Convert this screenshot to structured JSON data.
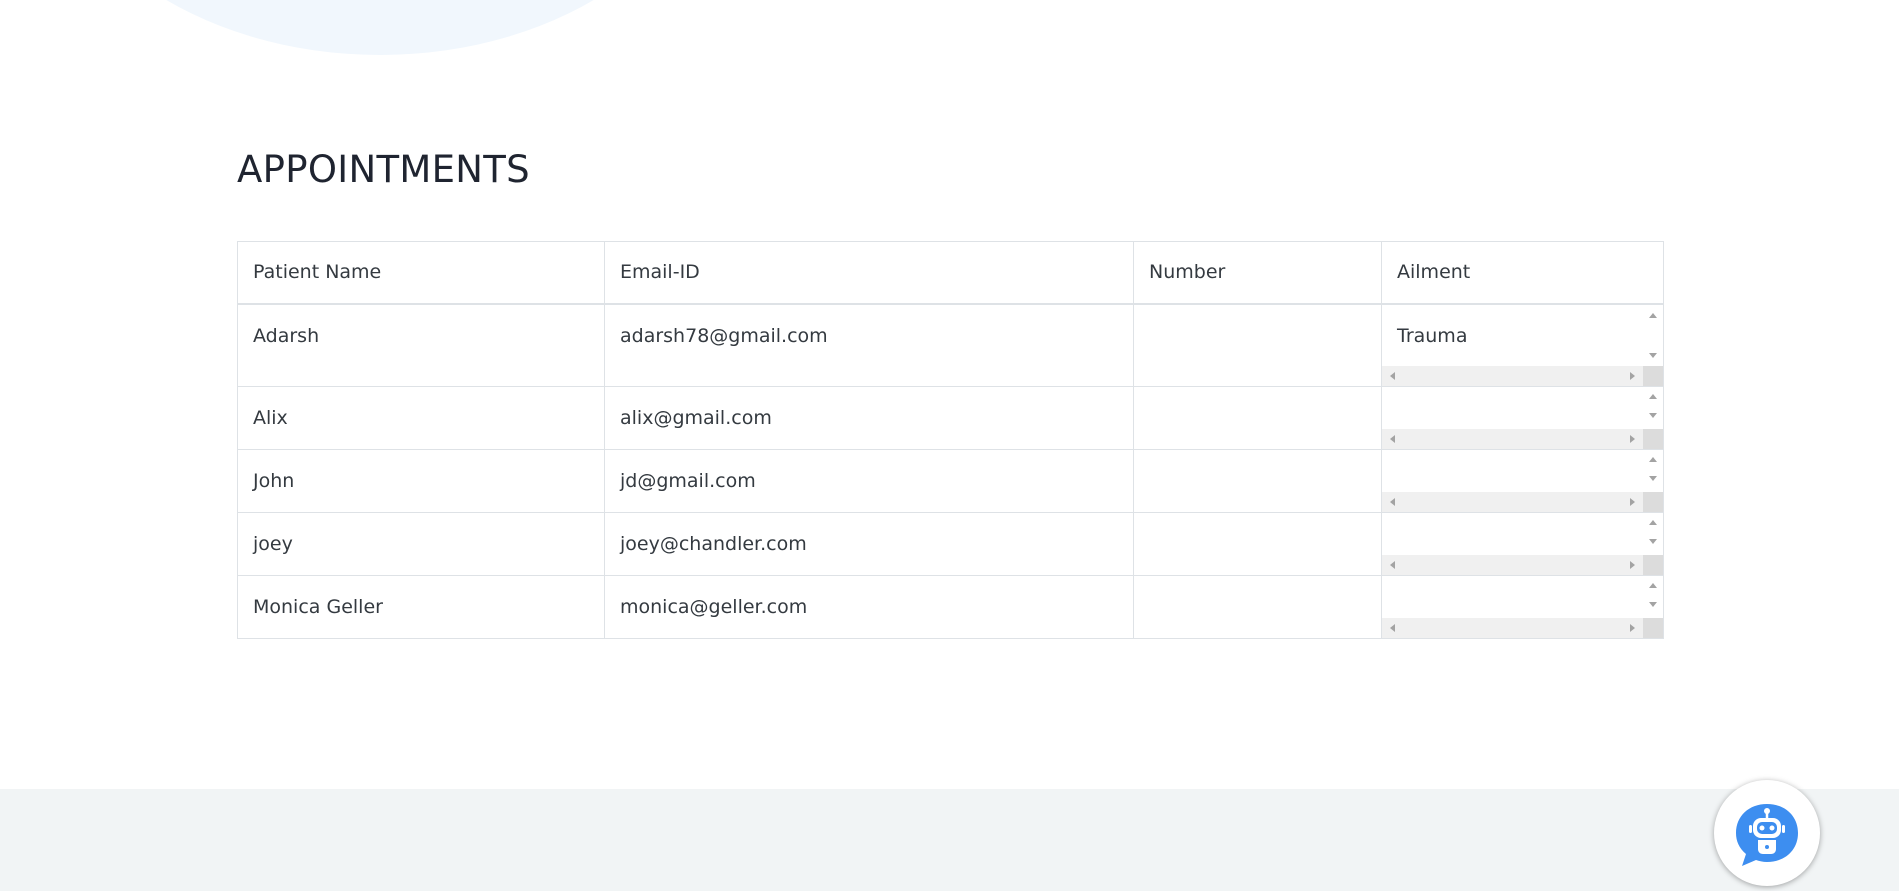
{
  "page": {
    "title": "APPOINTMENTS"
  },
  "table": {
    "headers": [
      "Patient Name",
      "Email-ID",
      "Number",
      "Ailment"
    ],
    "rows": [
      {
        "name": "Adarsh",
        "email": "adarsh78@gmail.com",
        "number": "",
        "ailment": "Trauma"
      },
      {
        "name": "Alix",
        "email": "alix@gmail.com",
        "number": "",
        "ailment": ""
      },
      {
        "name": "John",
        "email": "jd@gmail.com",
        "number": "",
        "ailment": ""
      },
      {
        "name": "joey",
        "email": "joey@chandler.com",
        "number": "",
        "ailment": ""
      },
      {
        "name": "Monica Geller",
        "email": "monica@geller.com",
        "number": "",
        "ailment": ""
      }
    ]
  },
  "chat_widget": {
    "icon": "chatbot-robot-icon",
    "accent_color": "#3d8ef0"
  },
  "colors": {
    "background": "#ffffff",
    "footer": "#f1f4f5",
    "blob": "#f1f7fd",
    "border": "#dee2e6"
  }
}
